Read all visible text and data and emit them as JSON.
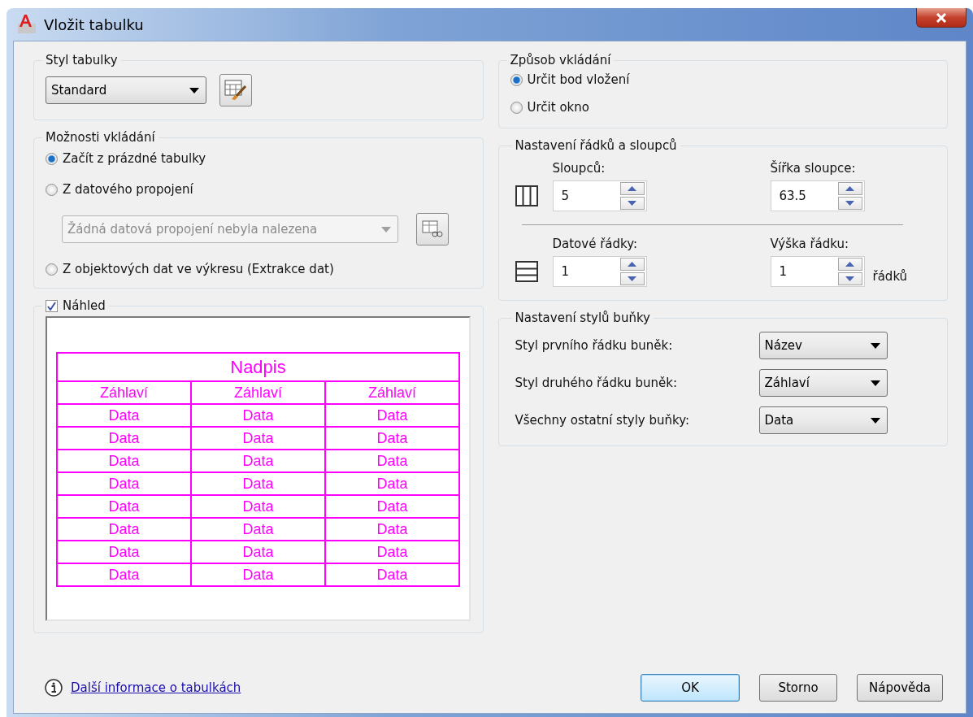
{
  "window": {
    "title": "Vložit tabulku"
  },
  "table_style": {
    "label": "Styl tabulky",
    "value": "Standard"
  },
  "insert_options": {
    "label": "Možnosti vkládání",
    "options": [
      {
        "label": "Začít z prázdné tabulky",
        "selected": true
      },
      {
        "label": "Z datového propojení",
        "selected": false
      },
      {
        "label": "Z objektových dat ve výkresu (Extrakce dat)",
        "selected": false
      }
    ],
    "link_dropdown": {
      "value": "Žádná datová propojení nebyla nalezena",
      "disabled": true
    }
  },
  "preview": {
    "label": "Náhled",
    "checked": true,
    "table": {
      "title": "Nadpis",
      "headers": [
        "Záhlaví",
        "Záhlaví",
        "Záhlaví"
      ],
      "rows": [
        [
          "Data",
          "Data",
          "Data"
        ],
        [
          "Data",
          "Data",
          "Data"
        ],
        [
          "Data",
          "Data",
          "Data"
        ],
        [
          "Data",
          "Data",
          "Data"
        ],
        [
          "Data",
          "Data",
          "Data"
        ],
        [
          "Data",
          "Data",
          "Data"
        ],
        [
          "Data",
          "Data",
          "Data"
        ],
        [
          "Data",
          "Data",
          "Data"
        ]
      ]
    }
  },
  "insertion_behavior": {
    "label": "Způsob vkládání",
    "options": [
      {
        "label": "Určit bod vložení",
        "selected": true
      },
      {
        "label": "Určit okno",
        "selected": false
      }
    ]
  },
  "rows_columns": {
    "label": "Nastavení řádků a sloupců",
    "rows": [
      {
        "kind": "columns",
        "fields": [
          {
            "label": "Sloupců:",
            "value": "5"
          },
          {
            "label": "Šířka sloupce:",
            "value": "63.5"
          }
        ]
      },
      {
        "kind": "rows",
        "fields": [
          {
            "label": "Datové řádky:",
            "value": "1"
          },
          {
            "label": "Výška řádku:",
            "value": "1",
            "unit": "řádků"
          }
        ]
      }
    ]
  },
  "cell_styles": {
    "label": "Nastavení stylů buňky",
    "items": [
      {
        "label": "Styl prvního řádku buněk:",
        "value": "Název"
      },
      {
        "label": "Styl druhého řádku buněk:",
        "value": "Záhlaví"
      },
      {
        "label": "Všechny ostatní styly buňky:",
        "value": "Data"
      }
    ]
  },
  "footer": {
    "link": "Další informace o tabulkách",
    "buttons": [
      {
        "label": "OK",
        "default": true
      },
      {
        "label": "Storno",
        "default": false
      },
      {
        "label": "Nápověda",
        "default": false
      }
    ]
  }
}
